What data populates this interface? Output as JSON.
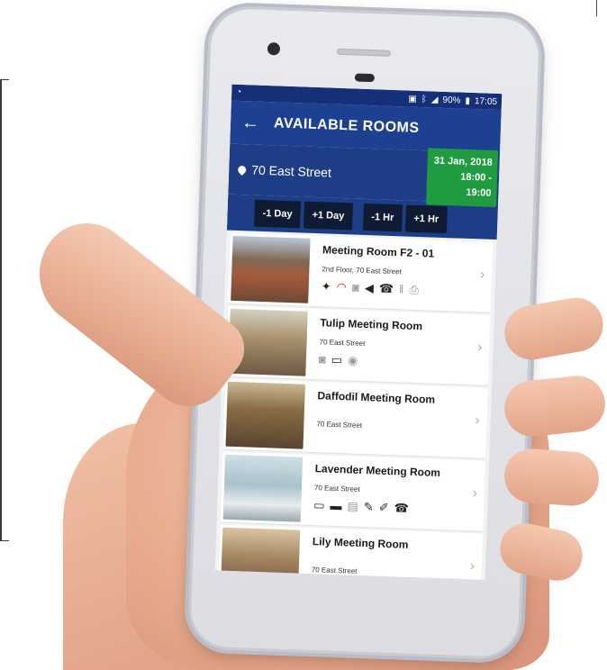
{
  "status": {
    "left_icon": "whatsapp-icon",
    "right_icons": [
      "sim-icon",
      "bluetooth-icon",
      "signal-icon",
      "wifi-icon",
      "battery-icon"
    ],
    "battery": "90%",
    "time": "17:05"
  },
  "appbar": {
    "title": "AVAILABLE ROOMS"
  },
  "location": "70 East Street",
  "date_box": {
    "date": "31 Jan, 2018",
    "time": "18:00 - 19:00"
  },
  "buttons": {
    "minus_day": "-1 Day",
    "plus_day": "+1 Day",
    "minus_hr": "-1 Hr",
    "plus_hr": "+1 Hr"
  },
  "colors": {
    "appbar": "#1d4190",
    "date_box": "#1f9c3f",
    "button": "#0f1a33"
  },
  "rooms": [
    {
      "name": "Meeting Room F2 - 01",
      "address": "2nd Floor, 70 East Street",
      "amenities": [
        "video-conference-icon",
        "wifi-icon",
        "projector-icon",
        "speaker-icon",
        "telephone-icon",
        "catering-icon",
        "printer-icon"
      ]
    },
    {
      "name": "Tulip Meeting Room",
      "address": "70 East Street",
      "amenities": [
        "projector-icon",
        "display-icon",
        "camera-icon"
      ]
    },
    {
      "name": "Daffodil Meeting Room",
      "address": "70 East Street",
      "amenities": []
    },
    {
      "name": "Lavender Meeting Room",
      "address": "70 East Street",
      "amenities": [
        "monitor-icon",
        "display-icon",
        "whiteboard-icon",
        "stationery-icon",
        "marker-icon",
        "telephone-icon"
      ]
    },
    {
      "name": "Lily Meeting Room",
      "address": "70 East Street",
      "amenities": []
    }
  ]
}
